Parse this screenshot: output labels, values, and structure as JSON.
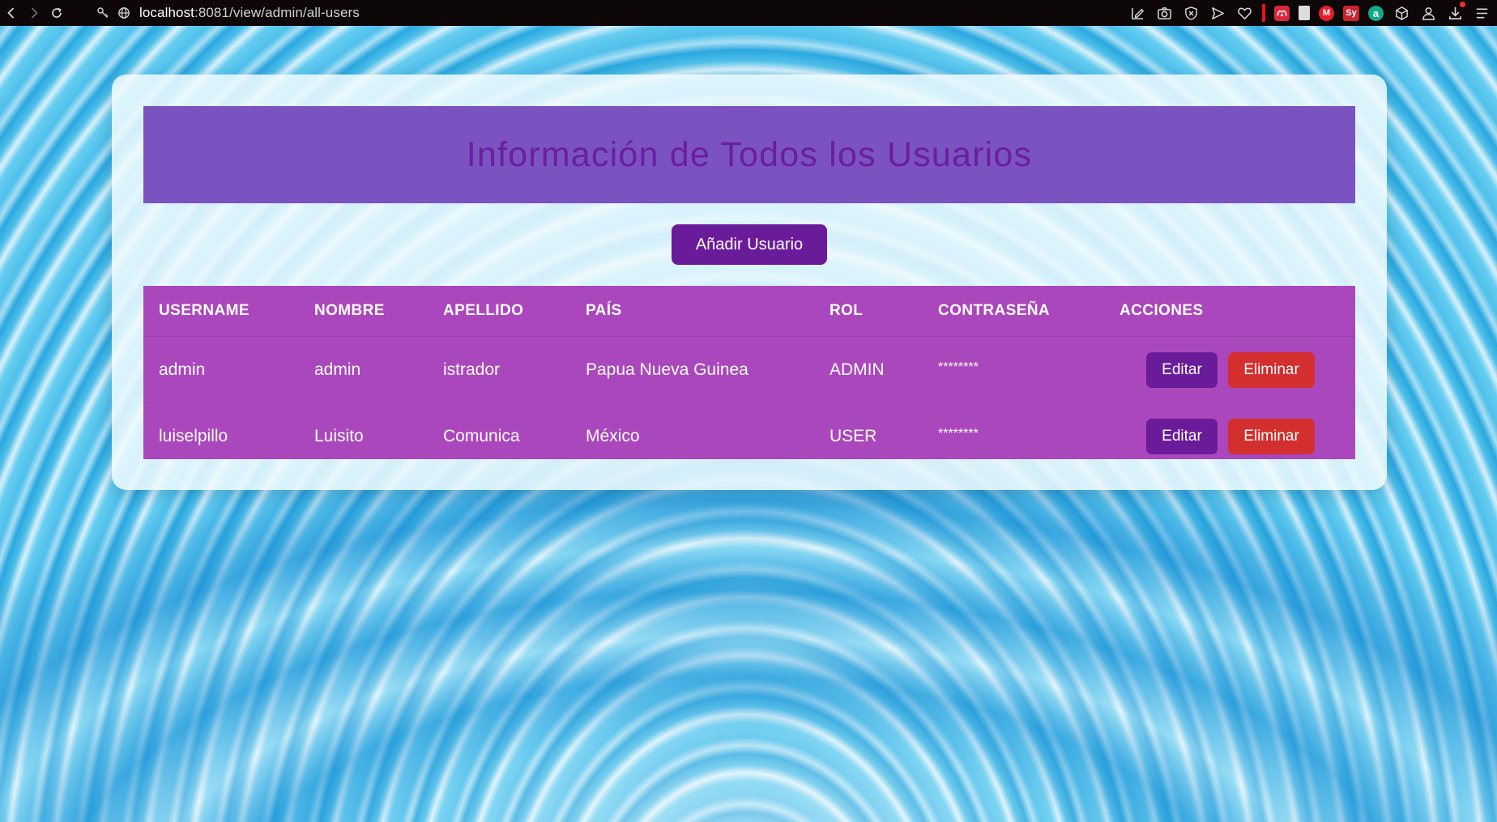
{
  "browser": {
    "url_host": "localhost",
    "url_rest": ":8081/view/admin/all-users",
    "icons": {
      "back": "chevron-left-icon",
      "forward": "chevron-right-icon",
      "reload": "reload-icon",
      "site_info": "key-icon",
      "globe": "globe-icon"
    },
    "extensions": [
      "screenshot-edit-icon",
      "camera-icon",
      "shield-x-icon",
      "send-icon",
      "heart-icon",
      "red-bar",
      "mendeley-icon",
      "document-icon",
      "gmail-m-icon",
      "sy-icon",
      "a-icon",
      "cube-icon",
      "person-icon",
      "download-icon",
      "list-icon"
    ],
    "colors": {
      "toolbar": "#0d0707"
    }
  },
  "page": {
    "title": "Información de Todos los Usuarios",
    "add_button": "Añadir Usuario",
    "table": {
      "headers": [
        "USERNAME",
        "NOMBRE",
        "APELLIDO",
        "PAÍS",
        "ROL",
        "CONTRASEÑA",
        "ACCIONES"
      ],
      "rows": [
        {
          "username": "admin",
          "nombre": "admin",
          "apellido": "istrador",
          "pais": "Papua Nueva Guinea",
          "rol": "ADMIN",
          "password": "********",
          "edit": "Editar",
          "delete": "Eliminar"
        },
        {
          "username": "luiselpillo",
          "nombre": "Luisito",
          "apellido": "Comunica",
          "pais": "México",
          "rol": "USER",
          "password": "********",
          "edit": "Editar",
          "delete": "Eliminar"
        }
      ]
    },
    "colors": {
      "banner": "#7b53c1",
      "title_text": "#6a1e9e",
      "table": "#ab47bc",
      "primary_button": "#6a1b9a",
      "danger_button": "#d32f2f"
    }
  }
}
